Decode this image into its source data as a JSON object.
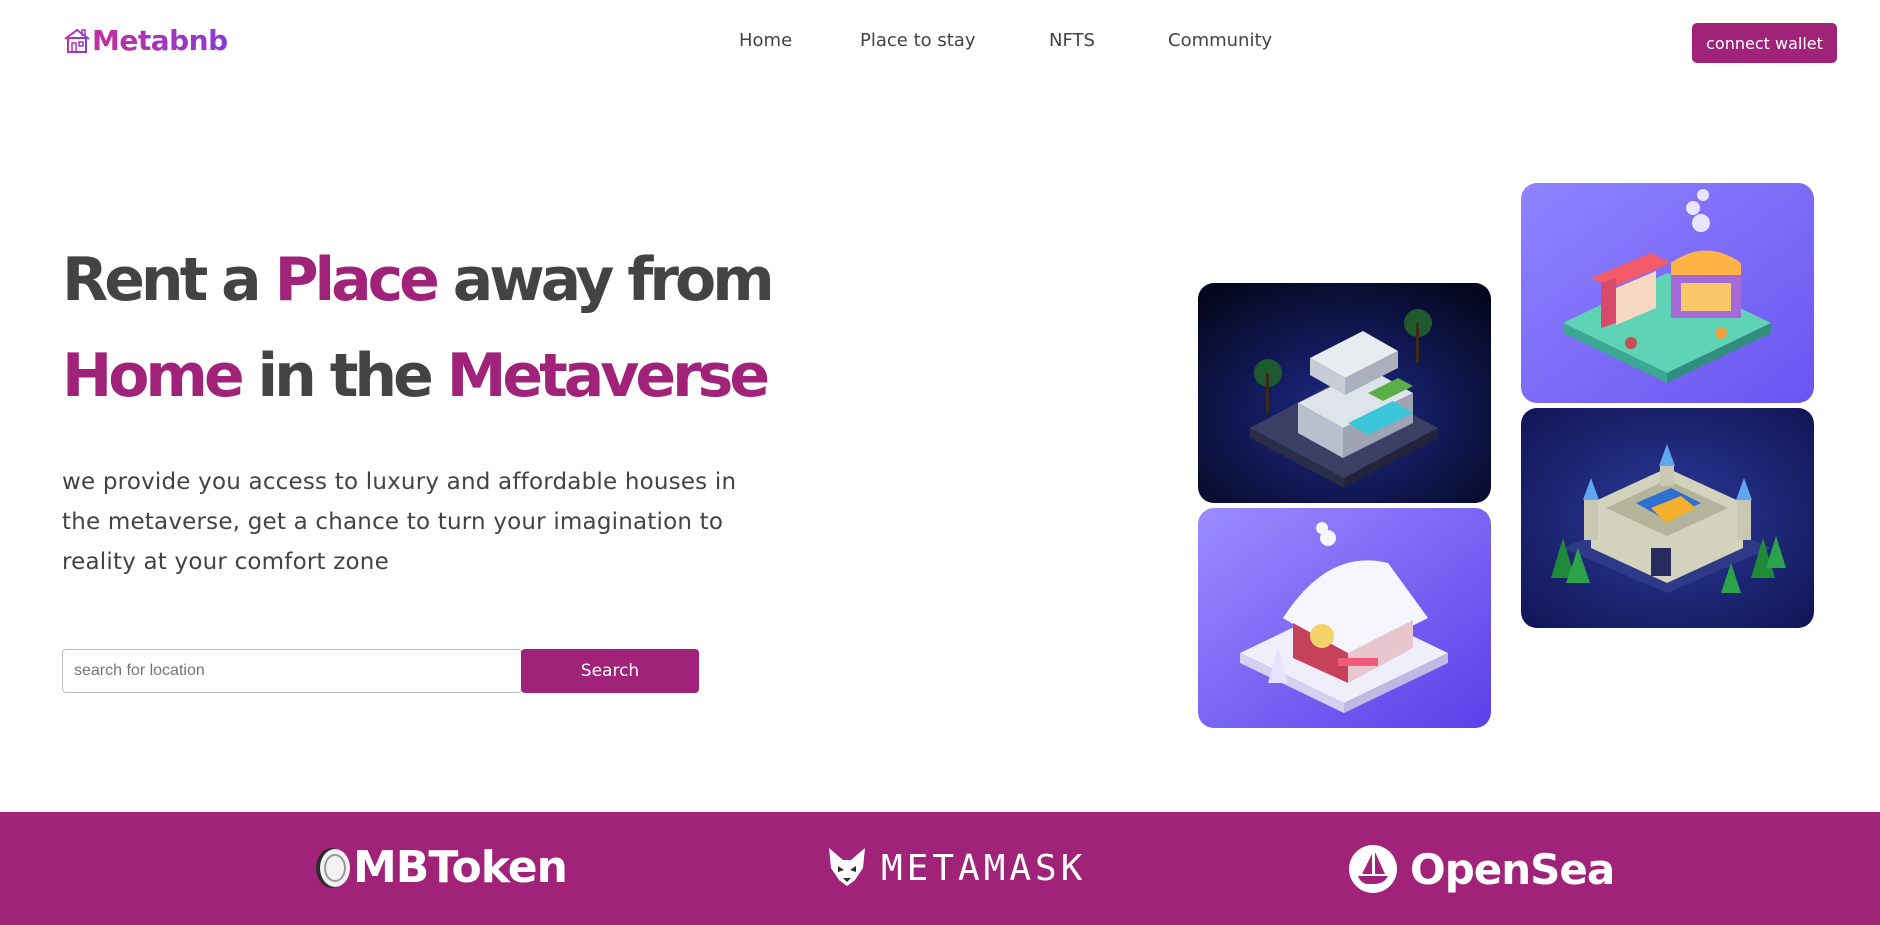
{
  "header": {
    "logo_text": "Metabnb",
    "nav": [
      "Home",
      "Place to stay",
      "NFTS",
      "Community"
    ],
    "connect_label": "connect wallet"
  },
  "hero": {
    "title_parts": [
      "Rent a ",
      "Place",
      " away from",
      "Home",
      " in the ",
      "Metaverse"
    ],
    "description": "we provide you access to luxury and affordable houses in the metaverse, get a chance to turn your imagination to reality at your comfort zone",
    "search_placeholder": "search for location",
    "search_label": "Search"
  },
  "gallery": [
    "modern-villa-image",
    "market-stall-image",
    "snow-cottage-image",
    "castle-image"
  ],
  "partners": [
    "MBToken",
    "METAMASK",
    "OpenSea"
  ],
  "colors": {
    "accent": "#a02279",
    "text": "#434343"
  }
}
